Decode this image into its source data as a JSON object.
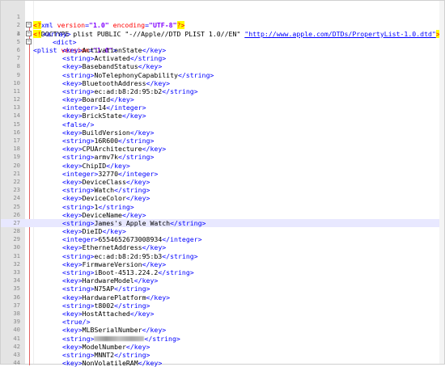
{
  "editor": {
    "xml_decl": {
      "open": "<?",
      "name": "xml",
      "version_attr": "version",
      "version_val": "\"1.0\"",
      "enc_attr": "encoding",
      "enc_val": "\"UTF-8\"",
      "close": "?>"
    },
    "doctype": {
      "open": "<!",
      "text": "DOCTYPE plist PUBLIC \"-//Apple//DTD PLIST 1.0//EN\" ",
      "url": "\"http://www.apple.com/DTDs/PropertyList-1.0.dtd\"",
      "close": ">"
    },
    "plist_open": {
      "tag": "<plist",
      "attr": "version",
      "val": "\"1.0\"",
      "end": ">"
    },
    "lines": [
      {
        "n": "4",
        "indent": 1,
        "raw": "<array>"
      },
      {
        "n": "5",
        "indent": 2,
        "raw": "<dict>"
      },
      {
        "n": "6",
        "indent": 3,
        "type": "key",
        "text": "ActivationState"
      },
      {
        "n": "7",
        "indent": 3,
        "type": "string",
        "text": "Activated"
      },
      {
        "n": "8",
        "indent": 3,
        "type": "key",
        "text": "BasebandStatus"
      },
      {
        "n": "9",
        "indent": 3,
        "type": "string",
        "text": "NoTelephonyCapability"
      },
      {
        "n": "10",
        "indent": 3,
        "type": "key",
        "text": "BluetoothAddress"
      },
      {
        "n": "11",
        "indent": 3,
        "type": "string",
        "text": "ec:ad:b8:2d:95:b2"
      },
      {
        "n": "12",
        "indent": 3,
        "type": "key",
        "text": "BoardId"
      },
      {
        "n": "13",
        "indent": 3,
        "type": "integer",
        "text": "14"
      },
      {
        "n": "14",
        "indent": 3,
        "type": "key",
        "text": "BrickState"
      },
      {
        "n": "15",
        "indent": 3,
        "raw": "<false/>"
      },
      {
        "n": "16",
        "indent": 3,
        "type": "key",
        "text": "BuildVersion"
      },
      {
        "n": "17",
        "indent": 3,
        "type": "string",
        "text": "16R600"
      },
      {
        "n": "18",
        "indent": 3,
        "type": "key",
        "text": "CPUArchitecture"
      },
      {
        "n": "19",
        "indent": 3,
        "type": "string",
        "text": "armv7k"
      },
      {
        "n": "20",
        "indent": 3,
        "type": "key",
        "text": "ChipID"
      },
      {
        "n": "21",
        "indent": 3,
        "type": "integer",
        "text": "32770"
      },
      {
        "n": "22",
        "indent": 3,
        "type": "key",
        "text": "DeviceClass"
      },
      {
        "n": "23",
        "indent": 3,
        "type": "string",
        "text": "Watch"
      },
      {
        "n": "24",
        "indent": 3,
        "type": "key",
        "text": "DeviceColor"
      },
      {
        "n": "25",
        "indent": 3,
        "type": "string",
        "text": "1"
      },
      {
        "n": "26",
        "indent": 3,
        "type": "key",
        "text": "DeviceName"
      },
      {
        "n": "27",
        "indent": 3,
        "type": "string",
        "text": "James's Apple Watch",
        "current": true
      },
      {
        "n": "28",
        "indent": 3,
        "type": "key",
        "text": "DieID"
      },
      {
        "n": "29",
        "indent": 3,
        "type": "integer",
        "text": "6554652673008934"
      },
      {
        "n": "30",
        "indent": 3,
        "type": "key",
        "text": "EthernetAddress"
      },
      {
        "n": "31",
        "indent": 3,
        "type": "string",
        "text": "ec:ad:b8:2d:95:b3"
      },
      {
        "n": "32",
        "indent": 3,
        "type": "key",
        "text": "FirmwareVersion"
      },
      {
        "n": "33",
        "indent": 3,
        "type": "string",
        "text": "iBoot-4513.224.2"
      },
      {
        "n": "34",
        "indent": 3,
        "type": "key",
        "text": "HardwareModel"
      },
      {
        "n": "35",
        "indent": 3,
        "type": "string",
        "text": "N75AP"
      },
      {
        "n": "36",
        "indent": 3,
        "type": "key",
        "text": "HardwarePlatform"
      },
      {
        "n": "37",
        "indent": 3,
        "type": "string",
        "text": "t8002"
      },
      {
        "n": "38",
        "indent": 3,
        "type": "key",
        "text": "HostAttached"
      },
      {
        "n": "39",
        "indent": 3,
        "raw": "<true/>"
      },
      {
        "n": "40",
        "indent": 3,
        "type": "key",
        "text": "MLBSerialNumber"
      },
      {
        "n": "41",
        "indent": 3,
        "type": "string",
        "text": "",
        "redacted": true
      },
      {
        "n": "42",
        "indent": 3,
        "type": "key",
        "text": "ModelNumber"
      },
      {
        "n": "43",
        "indent": 3,
        "type": "string",
        "text": "MNNT2"
      },
      {
        "n": "44",
        "indent": 3,
        "type": "key",
        "text": "NonVolatileRAM"
      }
    ],
    "line_numbers": {
      "l1": "1",
      "l2": "2",
      "l3": "3"
    },
    "colors": {
      "gutter": "#e4e4e4",
      "current_line": "#e8e8ff",
      "tag": "#0000ff",
      "attr": "#ff0000",
      "value": "#8000ff"
    }
  }
}
